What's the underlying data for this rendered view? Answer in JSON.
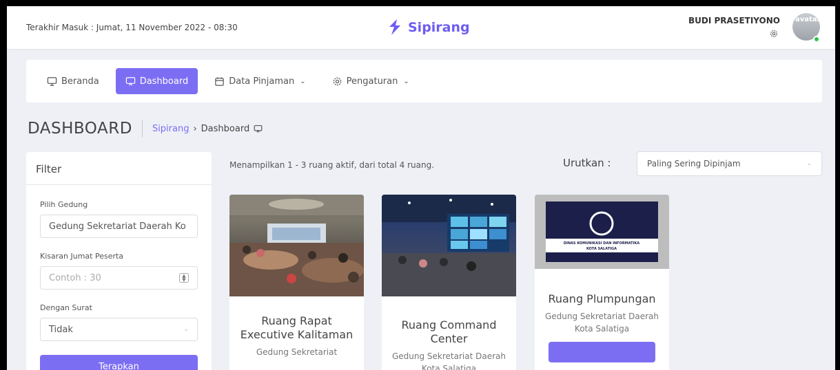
{
  "header": {
    "last_login": "Terakhir Masuk : Jumat, 11 November 2022 - 08:30",
    "brand": "Sipirang",
    "user_name": "BUDI PRASETIYONO",
    "avatar_alt": "avatar",
    "brand_color": "#6f5cf1",
    "online_color": "#2fc24f"
  },
  "nav": {
    "items": [
      {
        "label": "Beranda",
        "icon": "monitor-icon",
        "active": false
      },
      {
        "label": "Dashboard",
        "icon": "monitor-icon",
        "active": true
      },
      {
        "label": "Data Pinjaman",
        "icon": "calendar-icon",
        "has_dropdown": true
      },
      {
        "label": "Pengaturan",
        "icon": "gear-icon",
        "has_dropdown": true
      }
    ],
    "accent": "#7c6ef3"
  },
  "page": {
    "title": "DASHBOARD",
    "breadcrumb": [
      "Sipirang",
      "Dashboard"
    ]
  },
  "filter": {
    "title": "Filter",
    "building_label": "Pilih Gedung",
    "building_value": "Gedung Sekretariat Daerah Ko",
    "participants_label": "Kisaran Jumat Peserta",
    "participants_placeholder": "Contoh : 30",
    "letter_label": "Dengan Surat",
    "letter_value": "Tidak",
    "apply_label": "Terapkan"
  },
  "results": {
    "summary": "Menampilkan 1 - 3 ruang aktif, dari total 4 ruang.",
    "sort_label": "Urutkan :",
    "sort_value": "Paling Sering Dipinjam"
  },
  "rooms": [
    {
      "title": "Ruang Rapat Executive Kalitaman",
      "building": "Gedung Sekretariat"
    },
    {
      "title": "Ruang Command Center",
      "building": "Gedung Sekretariat Daerah Kota Salatiga"
    },
    {
      "title": "Ruang Plumpungan",
      "building": "Gedung Sekretariat Daerah Kota Salatiga"
    }
  ],
  "room_image_text": {
    "line1": "DINAS KOMUNIKASI DAN INFORMATIKA",
    "line2": "KOTA SALATIGA"
  }
}
